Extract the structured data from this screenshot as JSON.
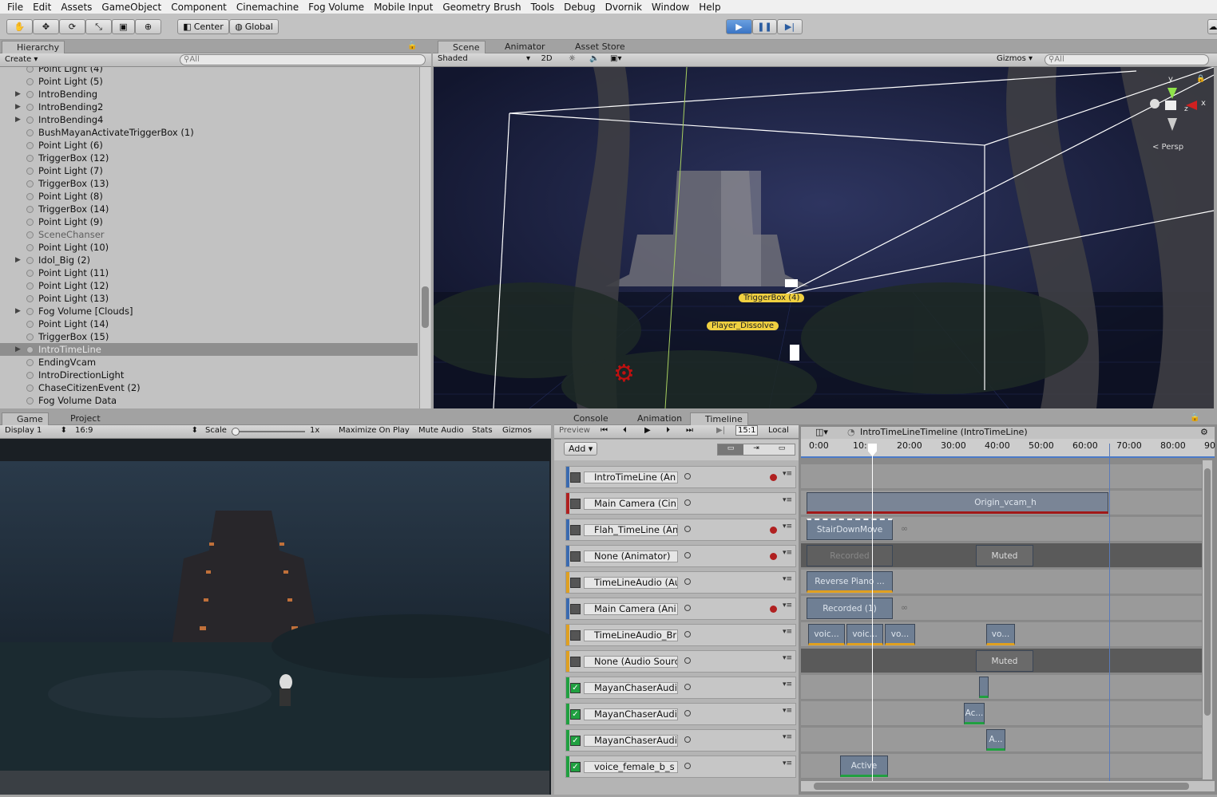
{
  "menu": [
    "File",
    "Edit",
    "Assets",
    "GameObject",
    "Component",
    "Cinemachine",
    "Fog Volume",
    "Mobile Input",
    "Geometry Brush",
    "Tools",
    "Debug",
    "Dvornik",
    "Window",
    "Help"
  ],
  "toolbar": {
    "center_label": "Center",
    "global_label": "Global"
  },
  "hierarchy": {
    "tab": "Hierarchy",
    "create": "Create",
    "search_placeholder": "All",
    "items": [
      {
        "label": "Point Light (4)",
        "arrow": false,
        "sel": false,
        "dim": false
      },
      {
        "label": "Point Light (5)",
        "arrow": false,
        "sel": false,
        "dim": false
      },
      {
        "label": "IntroBending",
        "arrow": true,
        "sel": false,
        "dim": false
      },
      {
        "label": "IntroBending2",
        "arrow": true,
        "sel": false,
        "dim": false
      },
      {
        "label": "IntroBending4",
        "arrow": true,
        "sel": false,
        "dim": false
      },
      {
        "label": "BushMayanActivateTriggerBox (1)",
        "arrow": false,
        "sel": false,
        "dim": false
      },
      {
        "label": "Point Light (6)",
        "arrow": false,
        "sel": false,
        "dim": false
      },
      {
        "label": "TriggerBox (12)",
        "arrow": false,
        "sel": false,
        "dim": false
      },
      {
        "label": "Point Light (7)",
        "arrow": false,
        "sel": false,
        "dim": false
      },
      {
        "label": "TriggerBox (13)",
        "arrow": false,
        "sel": false,
        "dim": false
      },
      {
        "label": "Point Light (8)",
        "arrow": false,
        "sel": false,
        "dim": false
      },
      {
        "label": "TriggerBox (14)",
        "arrow": false,
        "sel": false,
        "dim": false
      },
      {
        "label": "Point Light (9)",
        "arrow": false,
        "sel": false,
        "dim": false
      },
      {
        "label": "SceneChanser",
        "arrow": false,
        "sel": false,
        "dim": true
      },
      {
        "label": "Point Light (10)",
        "arrow": false,
        "sel": false,
        "dim": false
      },
      {
        "label": "Idol_Big (2)",
        "arrow": true,
        "sel": false,
        "dim": false
      },
      {
        "label": "Point Light (11)",
        "arrow": false,
        "sel": false,
        "dim": false
      },
      {
        "label": "Point Light (12)",
        "arrow": false,
        "sel": false,
        "dim": false
      },
      {
        "label": "Point Light (13)",
        "arrow": false,
        "sel": false,
        "dim": false
      },
      {
        "label": "Fog Volume [Clouds]",
        "arrow": true,
        "sel": false,
        "dim": false
      },
      {
        "label": "Point Light (14)",
        "arrow": false,
        "sel": false,
        "dim": false
      },
      {
        "label": "TriggerBox (15)",
        "arrow": false,
        "sel": false,
        "dim": false
      },
      {
        "label": "IntroTimeLine",
        "arrow": true,
        "sel": true,
        "dim": false
      },
      {
        "label": "EndingVcam",
        "arrow": false,
        "sel": false,
        "dim": false
      },
      {
        "label": "IntroDirectionLight",
        "arrow": false,
        "sel": false,
        "dim": false
      },
      {
        "label": "ChaseCitizenEvent (2)",
        "arrow": false,
        "sel": false,
        "dim": false
      },
      {
        "label": "Fog Volume Data",
        "arrow": false,
        "sel": false,
        "dim": false
      }
    ]
  },
  "scene": {
    "tabs": [
      "Scene",
      "Animator",
      "Asset Store"
    ],
    "shaded": "Shaded",
    "mode2d": "2D",
    "gizmos": "Gizmos",
    "search_placeholder": "All",
    "persp": "< Persp",
    "axis_y": "y",
    "axis_x": "x",
    "axis_z": "z",
    "labels": [
      "TriggerBox (4)",
      "Player_Dissolve"
    ]
  },
  "game": {
    "tabs": [
      "Game",
      "Project"
    ],
    "display": "Display 1",
    "aspect": "16:9",
    "scale_label": "Scale",
    "scale_value": "1x",
    "buttons": [
      "Maximize On Play",
      "Mute Audio",
      "Stats",
      "Gizmos"
    ]
  },
  "timeline": {
    "tabs": [
      "Console",
      "Animation",
      "Timeline"
    ],
    "preview": "Preview",
    "frame": "15:1",
    "local": "Local",
    "add": "Add",
    "title": "IntroTimeLineTimeline (IntroTimeLine)",
    "ruler": [
      "0:00",
      "10:",
      "20:00",
      "30:00",
      "40:00",
      "50:00",
      "60:00",
      "70:00",
      "80:00",
      "90"
    ],
    "tracks": [
      {
        "name": "IntroTimeLine (An",
        "color": "#3a6ab0",
        "rec": true
      },
      {
        "name": "Main Camera (Cin",
        "color": "#b02020",
        "rec": false
      },
      {
        "name": "Flah_TimeLine (An",
        "color": "#3a6ab0",
        "rec": true
      },
      {
        "name": "None (Animator)",
        "color": "#3a6ab0",
        "rec": true
      },
      {
        "name": "TimeLineAudio (Au",
        "color": "#e0a020",
        "rec": false
      },
      {
        "name": "Main Camera (Ani",
        "color": "#3a6ab0",
        "rec": true
      },
      {
        "name": "TimeLineAudio_Br",
        "color": "#e0a020",
        "rec": false
      },
      {
        "name": "None (Audio Sourc",
        "color": "#e0a020",
        "rec": false
      },
      {
        "name": "MayanChaserAudi",
        "color": "#20a040",
        "rec": false
      },
      {
        "name": "MayanChaserAudi",
        "color": "#20a040",
        "rec": false
      },
      {
        "name": "MayanChaserAudi",
        "color": "#20a040",
        "rec": false
      },
      {
        "name": "voice_female_b_s",
        "color": "#20a040",
        "rec": false
      }
    ],
    "clips": {
      "origin": "Origin_vcam_h",
      "stair": "StairDownMove",
      "recorded": "Recorded",
      "muted1": "Muted",
      "reverse": "Reverse Piano ...",
      "recorded1": "Recorded (1)",
      "voice": [
        "voic...",
        "voic...",
        "vo...",
        "vo..."
      ],
      "muted2": "Muted",
      "ac": "Ac...",
      "a": "A...",
      "active": "Active"
    }
  }
}
